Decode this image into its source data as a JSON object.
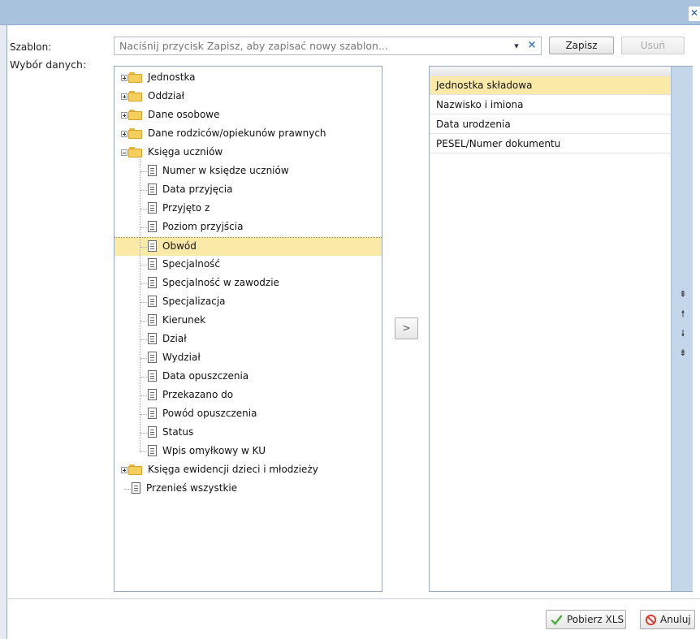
{
  "window": {
    "close_icon": "close-icon"
  },
  "form": {
    "template_label": "Szablon:",
    "template_placeholder": "Naciśnij przycisk Zapisz, aby zapisać nowy szablon...",
    "save_label": "Zapisz",
    "delete_label": "Usuń",
    "data_selection_label": "Wybór danych:"
  },
  "tree": {
    "items": [
      {
        "label": "Jednostka",
        "type": "folder",
        "expanded": false
      },
      {
        "label": "Oddział",
        "type": "folder",
        "expanded": false
      },
      {
        "label": "Dane osobowe",
        "type": "folder",
        "expanded": false
      },
      {
        "label": "Dane rodziców/opiekunów prawnych",
        "type": "folder",
        "expanded": false
      },
      {
        "label": "Księga uczniów",
        "type": "folder",
        "expanded": true
      },
      {
        "label": "Numer w księdze uczniów",
        "type": "leaf"
      },
      {
        "label": "Data przyjęcia",
        "type": "leaf"
      },
      {
        "label": "Przyjęto z",
        "type": "leaf"
      },
      {
        "label": "Poziom przyjścia",
        "type": "leaf"
      },
      {
        "label": "Obwód",
        "type": "leaf",
        "selected": true
      },
      {
        "label": "Specjalność",
        "type": "leaf"
      },
      {
        "label": "Specjalność w zawodzie",
        "type": "leaf"
      },
      {
        "label": "Specjalizacja",
        "type": "leaf"
      },
      {
        "label": "Kierunek",
        "type": "leaf"
      },
      {
        "label": "Dział",
        "type": "leaf"
      },
      {
        "label": "Wydział",
        "type": "leaf"
      },
      {
        "label": "Data opuszczenia",
        "type": "leaf"
      },
      {
        "label": "Przekazano do",
        "type": "leaf"
      },
      {
        "label": "Powód opuszczenia",
        "type": "leaf"
      },
      {
        "label": "Status",
        "type": "leaf"
      },
      {
        "label": "Wpis omyłkowy w KU",
        "type": "leaf"
      },
      {
        "label": "Księga ewidencji dzieci i młodzieży",
        "type": "folder",
        "expanded": false
      },
      {
        "label": "Przenieś wszystkie",
        "type": "root-leaf"
      }
    ]
  },
  "move_button_label": ">",
  "selected_list": {
    "items": [
      {
        "label": "Jednostka składowa",
        "selected": true
      },
      {
        "label": "Nazwisko i imiona"
      },
      {
        "label": "Data urodzenia"
      },
      {
        "label": "PESEL/Numer dokumentu"
      }
    ],
    "sidebar_icons": [
      "move-top-icon",
      "move-up-icon",
      "move-down-icon",
      "move-bottom-icon"
    ]
  },
  "footer": {
    "download_label": "Pobierz XLS",
    "cancel_label": "Anuluj"
  },
  "colors": {
    "selection": "#fbe9a8",
    "titlebar": "#a8c1dd",
    "sidebar": "#c3d6ea"
  }
}
